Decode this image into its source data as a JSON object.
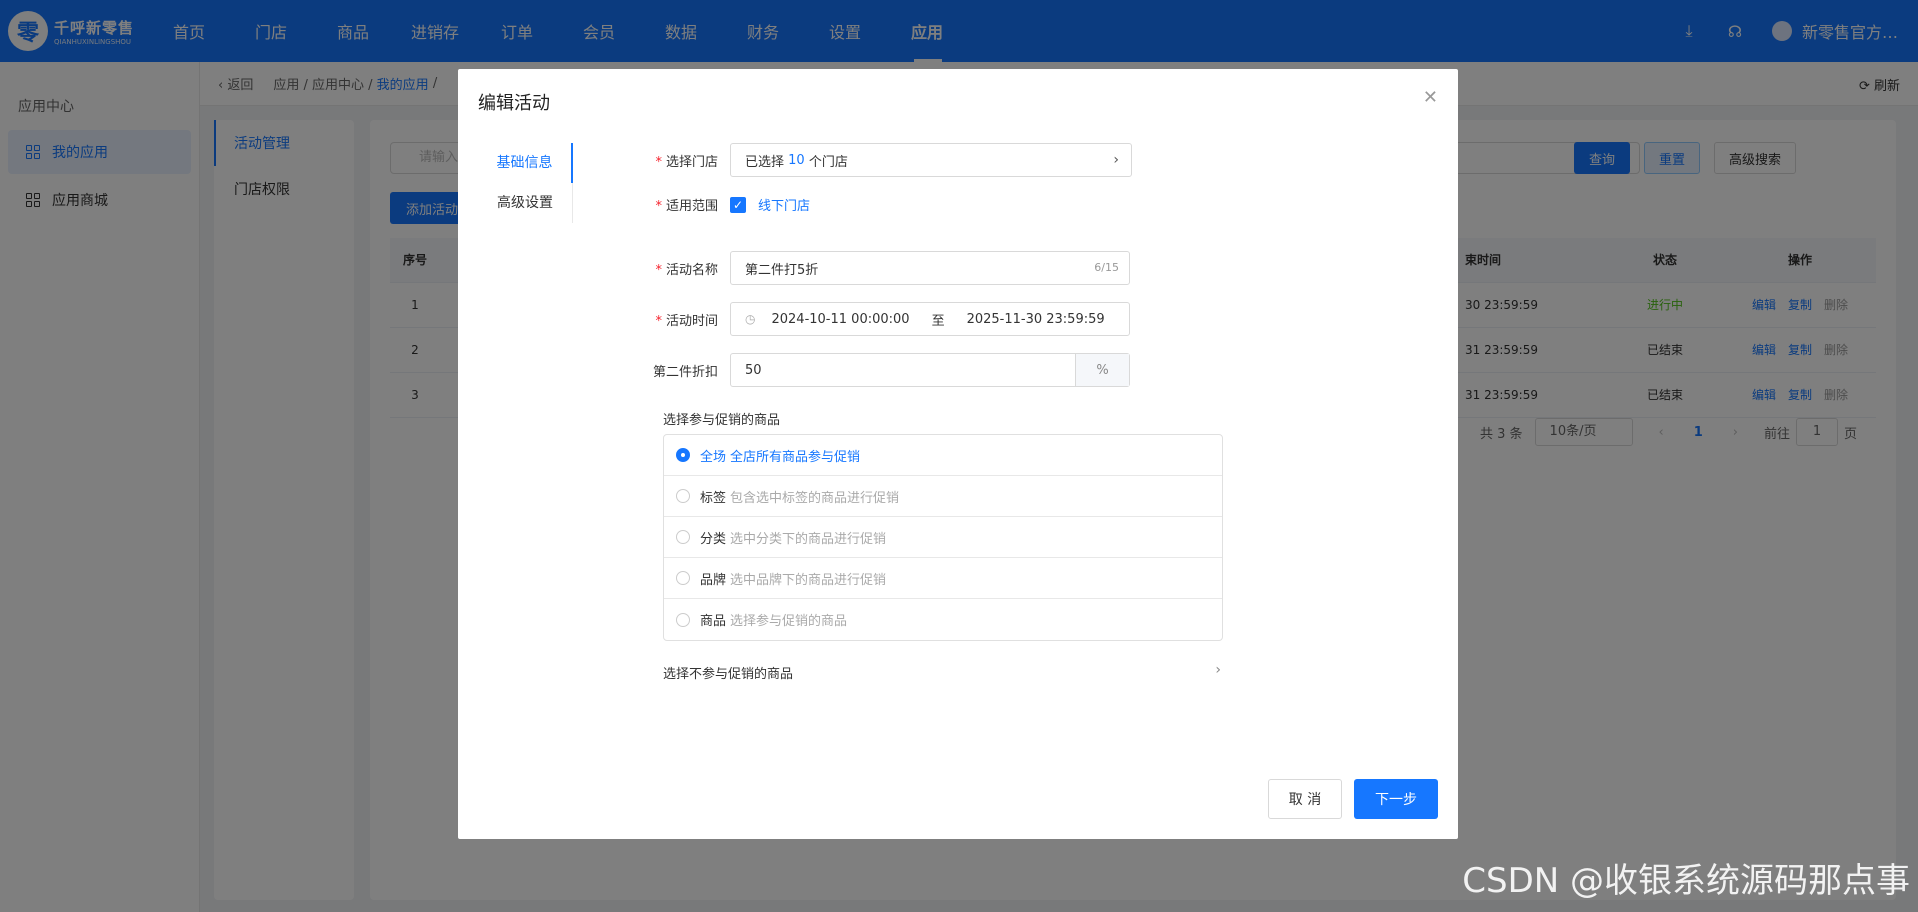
{
  "brand": {
    "name": "千呼新零售",
    "subtitle": "QIANHUXINLINGSHOU",
    "mark": "零"
  },
  "nav": [
    "首页",
    "门店",
    "商品",
    "进销存",
    "订单",
    "会员",
    "数据",
    "财务",
    "设置",
    "应用"
  ],
  "nav_active": "应用",
  "top_right": {
    "download_icon": "⤓",
    "support_icon": "☊",
    "user": "新零售官方…"
  },
  "sidebar": {
    "title": "应用中心",
    "items": [
      {
        "label": "我的应用",
        "active": true
      },
      {
        "label": "应用商城",
        "active": false
      }
    ]
  },
  "breadcrumb": {
    "back": "返回",
    "path1": "应用 / 应用中心 /",
    "current": "我的应用",
    "sep": "/",
    "refresh": "刷新"
  },
  "submenu": [
    "活动管理",
    "门店权限"
  ],
  "main": {
    "search_placeholder": "请输入",
    "add_button": "添加活动",
    "query": "查询",
    "reset": "重置",
    "advanced": "高级搜索",
    "headers": {
      "no": "序号",
      "time": "束时间",
      "status": "状态",
      "ops": "操作"
    },
    "rows": [
      {
        "no": "1",
        "time": "30 23:59:59",
        "status": "进行中"
      },
      {
        "no": "2",
        "time": "31 23:59:59",
        "status": "已结束"
      },
      {
        "no": "3",
        "time": "31 23:59:59",
        "status": "已结束"
      }
    ],
    "ops": {
      "edit": "编辑",
      "copy": "复制",
      "delete": "删除"
    },
    "pager": {
      "total": "共 3 条",
      "size": "10条/页",
      "page": "1",
      "goto": "前往",
      "goto_value": "1",
      "unit": "页"
    }
  },
  "modal": {
    "title": "编辑活动",
    "tabs": [
      "基础信息",
      "高级设置"
    ],
    "store": {
      "label": "选择门店",
      "prefix": "已选择",
      "count": "10",
      "suffix": "个门店"
    },
    "scope": {
      "label": "适用范围",
      "option": "线下门店"
    },
    "name": {
      "label": "活动名称",
      "value": "第二件打5折",
      "counter": "6/15"
    },
    "time": {
      "label": "活动时间",
      "start": "2024-10-11 00:00:00",
      "to": "至",
      "end": "2025-11-30 23:59:59"
    },
    "discount": {
      "label": "第二件折扣",
      "value": "50",
      "unit": "%"
    },
    "goods_title": "选择参与促销的商品",
    "goods_options": [
      {
        "name": "全场",
        "desc": "全店所有商品参与促销",
        "selected": true
      },
      {
        "name": "标签",
        "desc": "包含选中标签的商品进行促销",
        "selected": false
      },
      {
        "name": "分类",
        "desc": "选中分类下的商品进行促销",
        "selected": false
      },
      {
        "name": "品牌",
        "desc": "选中品牌下的商品进行促销",
        "selected": false
      },
      {
        "name": "商品",
        "desc": "选择参与促销的商品",
        "selected": false
      }
    ],
    "exclude": "选择不参与促销的商品",
    "cancel": "取 消",
    "next": "下一步"
  },
  "watermark": "CSDN @收银系统源码那点事",
  "colors": {
    "primary": "#1677ff",
    "success": "#52c41a",
    "required": "#f5222d"
  }
}
